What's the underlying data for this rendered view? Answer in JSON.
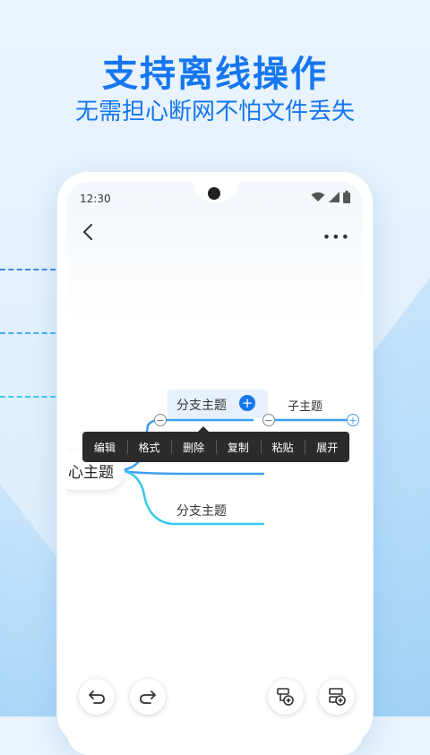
{
  "hero": {
    "title": "支持离线操作",
    "subtitle": "无需担心断网不怕文件丢失"
  },
  "colors": {
    "accent": "#1576f0",
    "menu_bg": "#2b2b2b",
    "branch_line": "#3b9ff0",
    "cyan_line": "#38c9ee"
  },
  "status_bar": {
    "time": "12:30",
    "icons": [
      "wifi-icon",
      "signal-icon",
      "battery-icon"
    ]
  },
  "toolbar": {
    "back_icon": "chevron-left-icon",
    "more_label": "•••"
  },
  "mindmap": {
    "root": "心主题",
    "branch_selected": "分支主题",
    "child": "子主题",
    "branch_bottom": "分支主题"
  },
  "context_menu": {
    "items": [
      "编辑",
      "格式",
      "删除",
      "复制",
      "粘贴",
      "展开"
    ]
  },
  "bottom_bar": {
    "buttons": [
      "undo-icon",
      "redo-icon",
      "add-child-node-icon",
      "add-sibling-node-icon"
    ]
  }
}
